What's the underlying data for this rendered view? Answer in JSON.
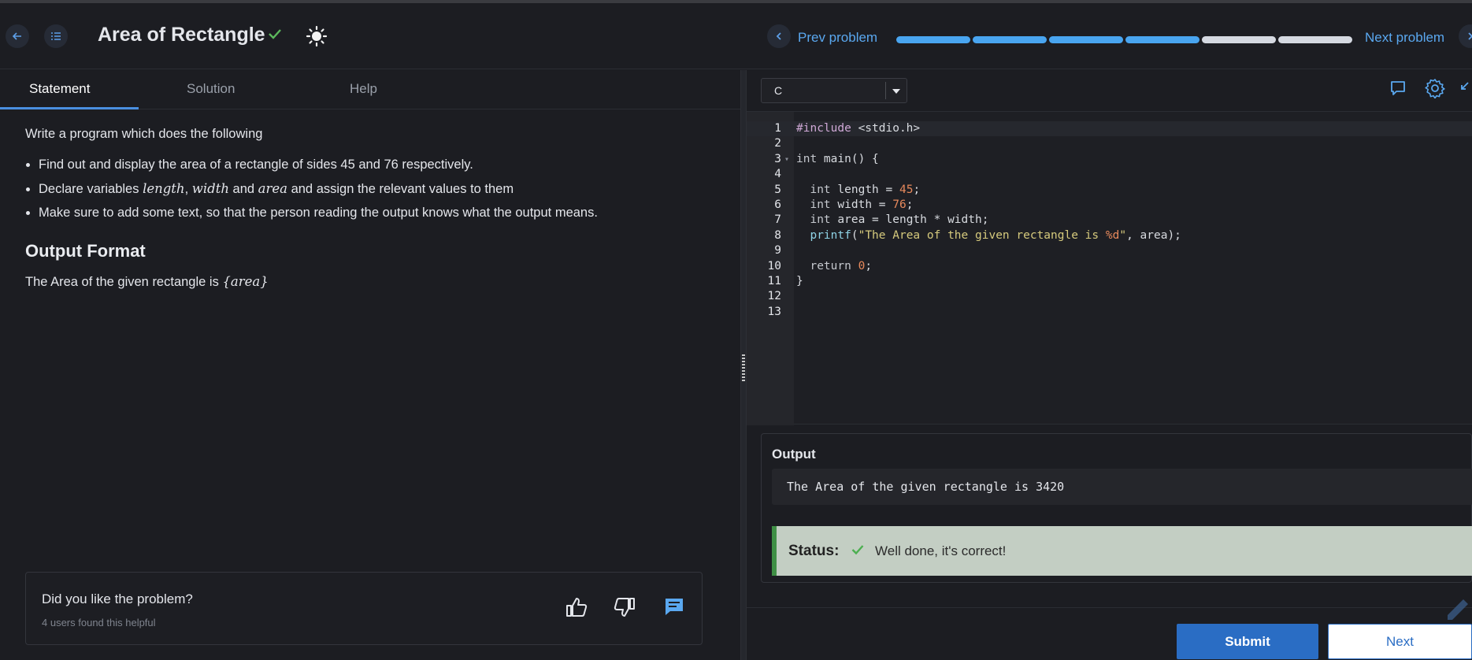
{
  "header": {
    "title": "Area of Rectangle",
    "prev_label": "Prev problem",
    "next_label": "Next problem",
    "progress": {
      "total": 6,
      "completed": 4
    }
  },
  "tabs": [
    {
      "label": "Statement",
      "active": true
    },
    {
      "label": "Solution",
      "active": false
    },
    {
      "label": "Help",
      "active": false
    }
  ],
  "statement": {
    "intro": "Write a program which does the following",
    "bullet1": "Find out and display the area of a rectangle of sides 45 and 76 respectively.",
    "bullet2": {
      "pre": "Declare variables ",
      "var1": "length",
      "comma": ", ",
      "var2": "width",
      "mid": " and ",
      "var3": "area",
      "post": " and assign the relevant values to them"
    },
    "bullet3": "Make sure to add some text, so that the person reading the output knows what the output means.",
    "output_heading": "Output Format",
    "output_pre": "The Area of the given rectangle is ",
    "output_var": "{area}"
  },
  "feedback": {
    "question": "Did you like the problem?",
    "count_text": "4 users found this helpful"
  },
  "editor": {
    "language": "C",
    "line_numbers": [
      "1",
      "2",
      "3",
      "4",
      "5",
      "6",
      "7",
      "8",
      "9",
      "10",
      "11",
      "12",
      "13"
    ]
  },
  "output": {
    "title": "Output",
    "text": "The Area of the given rectangle is 3420",
    "status_label": "Status:",
    "status_message": "Well done, it's correct!"
  },
  "actions": {
    "submit": "Submit",
    "next": "Next"
  },
  "colors": {
    "accent": "#49a5f0",
    "success": "#5cb85c",
    "submit_bg": "#2a6dc4"
  }
}
